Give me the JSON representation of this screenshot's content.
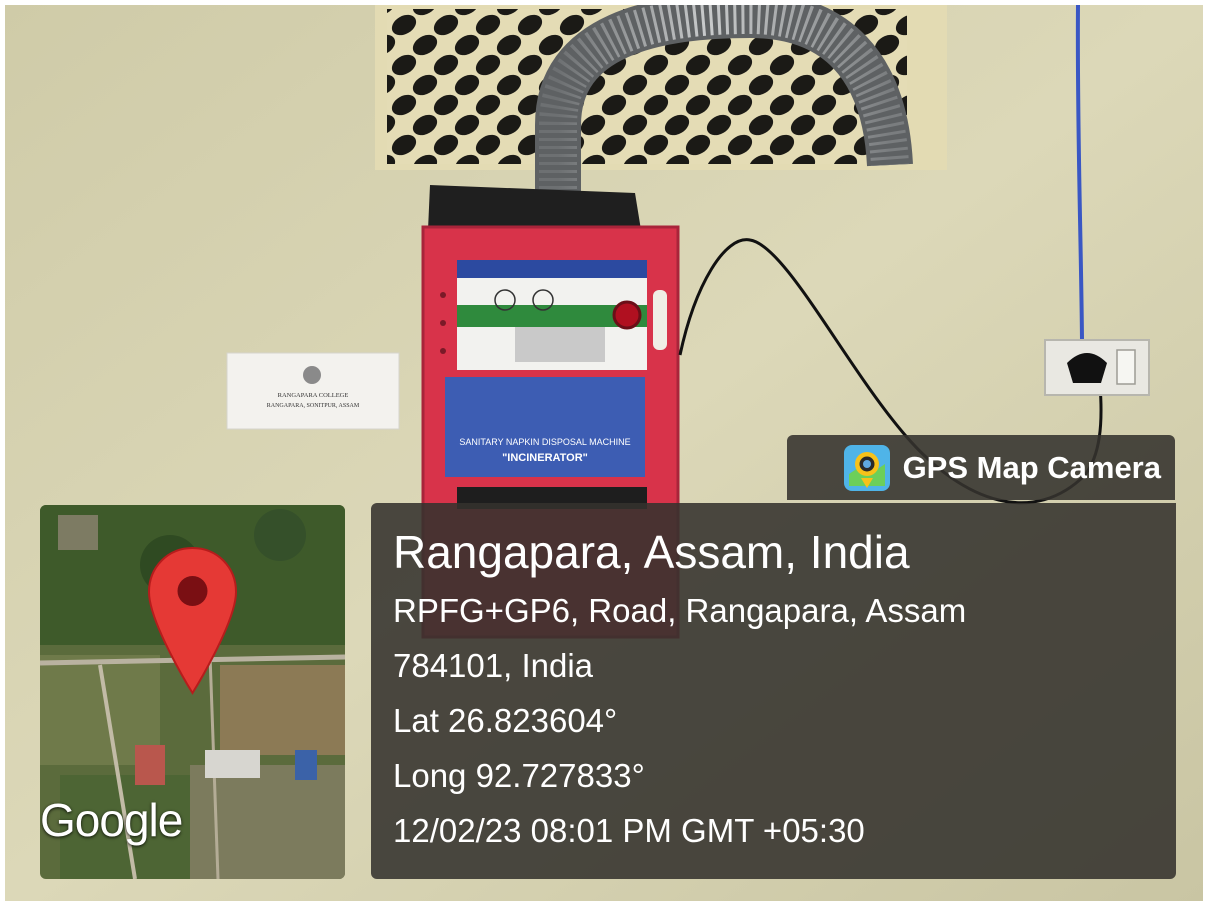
{
  "overlay": {
    "brand": "GPS Map Camera",
    "brand_icon": "gps-map-camera-app-icon",
    "place": "Rangapara, Assam, India",
    "address_line1": "RPFG+GP6, Road, Rangapara, Assam",
    "address_line2": "784101, India",
    "latitude": "Lat 26.823604°",
    "longitude": "Long 92.727833°",
    "datetime": "12/02/23 08:01 PM GMT +05:30"
  },
  "map": {
    "provider": "Google",
    "pin_icon": "map-pin-icon",
    "pin_color": "#e53935"
  },
  "scene": {
    "label_card": {
      "line1": "RANGAPARA COLLEGE",
      "line2": "RANGAPARA, SONITPUR, ASSAM"
    },
    "machine_panel_text": "SANITARY NAPKIN DISPOSAL MACHINE",
    "machine_panel_text2": "\"INCINERATOR\"",
    "colors": {
      "wall": "#d6d2b0",
      "machine_red": "#d8334a",
      "panel_blue": "#2f4fa8",
      "overlay_bg": "#34322e"
    }
  }
}
